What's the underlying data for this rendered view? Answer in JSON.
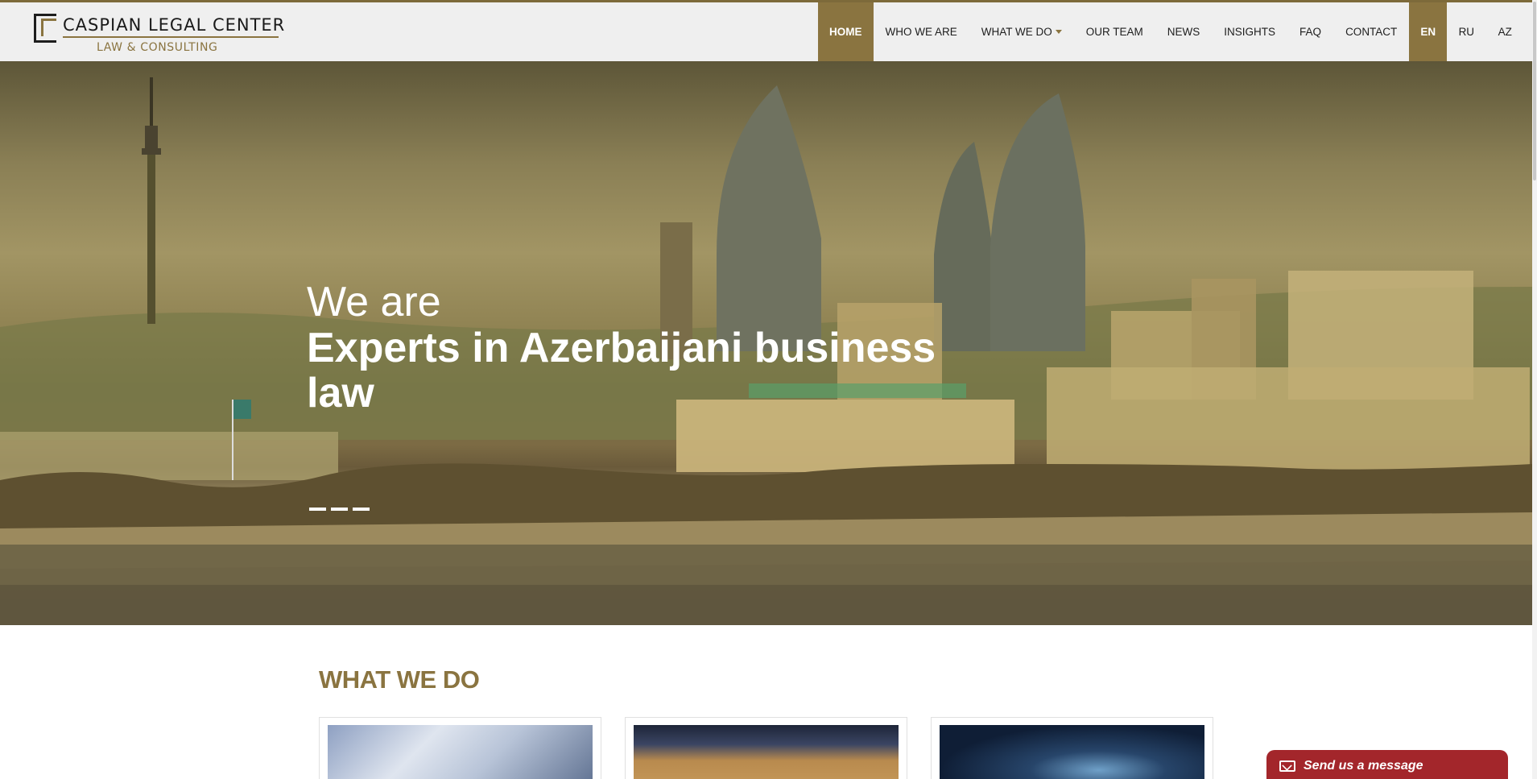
{
  "brand": {
    "name": "CASPIAN LEGAL CENTER",
    "tagline": "LAW & CONSULTING"
  },
  "nav": {
    "items": [
      {
        "label": "HOME",
        "active": true
      },
      {
        "label": "WHO WE ARE",
        "active": false
      },
      {
        "label": "WHAT WE DO",
        "active": false,
        "dropdown": true
      },
      {
        "label": "OUR TEAM",
        "active": false
      },
      {
        "label": "NEWS",
        "active": false
      },
      {
        "label": "INSIGHTS",
        "active": false
      },
      {
        "label": "FAQ",
        "active": false
      },
      {
        "label": "CONTACT",
        "active": false
      }
    ],
    "languages": [
      {
        "label": "EN",
        "active": true
      },
      {
        "label": "RU",
        "active": false
      },
      {
        "label": "AZ",
        "active": false
      }
    ]
  },
  "hero": {
    "intro": "We are",
    "headline": "Experts in Azerbaijani business law",
    "slide_count": 3
  },
  "what_we_do": {
    "title": "WHAT WE DO"
  },
  "message_button": {
    "label": "Send us a message",
    "icon": "envelope-icon"
  },
  "colors": {
    "accent": "#8a7440",
    "message_button": "#a3262b",
    "header_bg": "#efefef"
  }
}
